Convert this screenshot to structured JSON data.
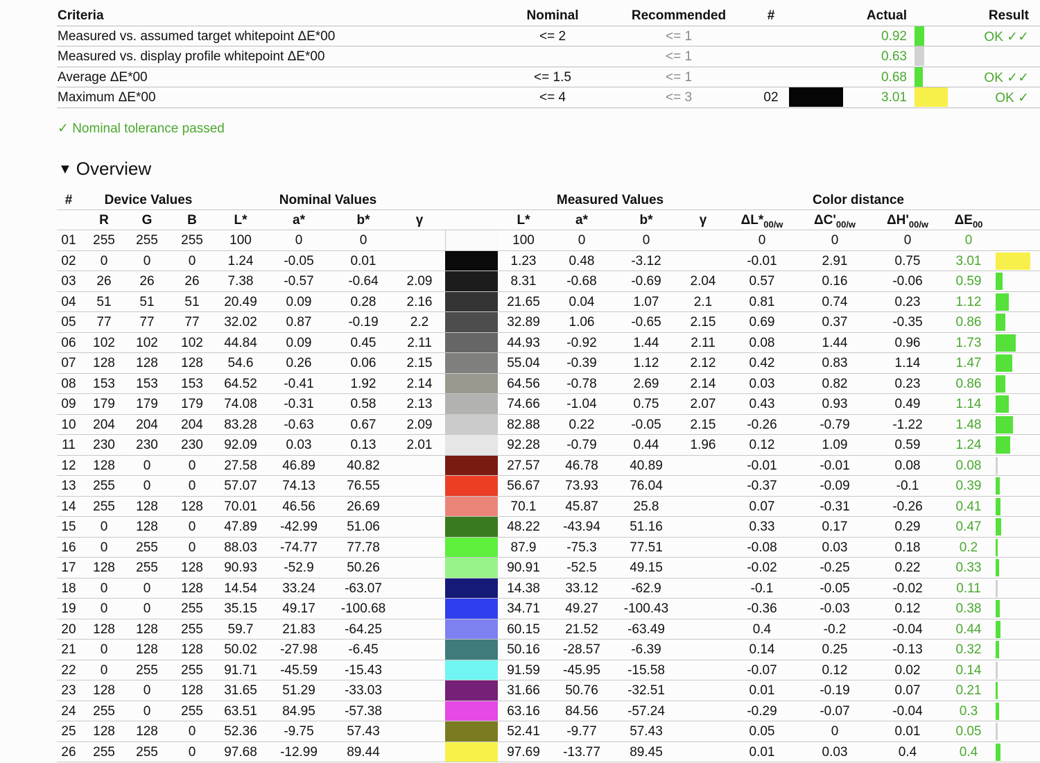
{
  "criteria": {
    "headers": {
      "criteria": "Criteria",
      "nominal": "Nominal",
      "recommended": "Recommended",
      "num": "#",
      "actual": "Actual",
      "result": "Result"
    },
    "rows": [
      {
        "criteria": "Measured vs. assumed target whitepoint ΔE*00",
        "nominal": "<= 2",
        "recommended": "<= 1",
        "num": "",
        "actual": "0.92",
        "result": "OK ✓✓",
        "bar_color": "#55e03a",
        "bar_fraction": 0.3
      },
      {
        "criteria": "Measured vs. display profile whitepoint ΔE*00",
        "nominal": "",
        "recommended": "<= 1",
        "num": "",
        "actual": "0.63",
        "result": "",
        "bar_color": "#d2d2d2",
        "bar_fraction": 0.3
      },
      {
        "criteria": "Average ΔE*00",
        "nominal": "<= 1.5",
        "recommended": "<= 1",
        "num": "",
        "actual": "0.68",
        "result": "OK ✓✓",
        "bar_color": "#55e03a",
        "bar_fraction": 0.25
      },
      {
        "criteria": "Maximum ΔE*00",
        "nominal": "<= 4",
        "recommended": "<= 3",
        "num": "02",
        "actual": "3.01",
        "result": "OK ✓",
        "bar_color": "#f7ef4a",
        "bar_fraction": 1.0,
        "swatch": "#050505"
      }
    ]
  },
  "status": "✓ Nominal tolerance passed",
  "overview": {
    "title": "Overview",
    "groups": {
      "num": "#",
      "device": "Device Values",
      "nominal": "Nominal Values",
      "measured": "Measured Values",
      "distance": "Color distance"
    },
    "columns": [
      "R",
      "G",
      "B",
      "L*",
      "a*",
      "b*",
      "γ",
      "L*",
      "a*",
      "b*",
      "γ"
    ],
    "dist_cols": [
      {
        "main": "ΔL*",
        "sub": "00/w"
      },
      {
        "main": "ΔC'",
        "sub": "00/w"
      },
      {
        "main": "ΔH'",
        "sub": "00/w"
      },
      {
        "main": "ΔE",
        "sub": "00"
      }
    ],
    "rows": [
      {
        "n": "01",
        "r": "255",
        "g": "255",
        "b": "255",
        "nL": "100",
        "na": "0",
        "nb": "0",
        "ng": "",
        "mL": "100",
        "ma": "0",
        "mb": "0",
        "mg": "",
        "dL": "0",
        "dC": "0",
        "dH": "0",
        "dE": "0",
        "color": "#fafafa"
      },
      {
        "n": "02",
        "r": "0",
        "g": "0",
        "b": "0",
        "nL": "1.24",
        "na": "-0.05",
        "nb": "0.01",
        "ng": "",
        "mL": "1.23",
        "ma": "0.48",
        "mb": "-3.12",
        "mg": "",
        "dL": "-0.01",
        "dC": "2.91",
        "dH": "0.75",
        "dE": "3.01",
        "color": "#0a0a0a"
      },
      {
        "n": "03",
        "r": "26",
        "g": "26",
        "b": "26",
        "nL": "7.38",
        "na": "-0.57",
        "nb": "-0.64",
        "ng": "2.09",
        "mL": "8.31",
        "ma": "-0.68",
        "mb": "-0.69",
        "mg": "2.04",
        "dL": "0.57",
        "dC": "0.16",
        "dH": "-0.06",
        "dE": "0.59",
        "color": "#1c1c1c"
      },
      {
        "n": "04",
        "r": "51",
        "g": "51",
        "b": "51",
        "nL": "20.49",
        "na": "0.09",
        "nb": "0.28",
        "ng": "2.16",
        "mL": "21.65",
        "ma": "0.04",
        "mb": "1.07",
        "mg": "2.1",
        "dL": "0.81",
        "dC": "0.74",
        "dH": "0.23",
        "dE": "1.12",
        "color": "#343434"
      },
      {
        "n": "05",
        "r": "77",
        "g": "77",
        "b": "77",
        "nL": "32.02",
        "na": "0.87",
        "nb": "-0.19",
        "ng": "2.2",
        "mL": "32.89",
        "ma": "1.06",
        "mb": "-0.65",
        "mg": "2.15",
        "dL": "0.69",
        "dC": "0.37",
        "dH": "-0.35",
        "dE": "0.86",
        "color": "#4d4d4d"
      },
      {
        "n": "06",
        "r": "102",
        "g": "102",
        "b": "102",
        "nL": "44.84",
        "na": "0.09",
        "nb": "0.45",
        "ng": "2.11",
        "mL": "44.93",
        "ma": "-0.92",
        "mb": "1.44",
        "mg": "2.11",
        "dL": "0.08",
        "dC": "1.44",
        "dH": "0.96",
        "dE": "1.73",
        "color": "#666666"
      },
      {
        "n": "07",
        "r": "128",
        "g": "128",
        "b": "128",
        "nL": "54.6",
        "na": "0.26",
        "nb": "0.06",
        "ng": "2.15",
        "mL": "55.04",
        "ma": "-0.39",
        "mb": "1.12",
        "mg": "2.12",
        "dL": "0.42",
        "dC": "0.83",
        "dH": "1.14",
        "dE": "1.47",
        "color": "#7f7f7d"
      },
      {
        "n": "08",
        "r": "153",
        "g": "153",
        "b": "153",
        "nL": "64.52",
        "na": "-0.41",
        "nb": "1.92",
        "ng": "2.14",
        "mL": "64.56",
        "ma": "-0.78",
        "mb": "2.69",
        "mg": "2.14",
        "dL": "0.03",
        "dC": "0.82",
        "dH": "0.23",
        "dE": "0.86",
        "color": "#99998f"
      },
      {
        "n": "09",
        "r": "179",
        "g": "179",
        "b": "179",
        "nL": "74.08",
        "na": "-0.31",
        "nb": "0.58",
        "ng": "2.13",
        "mL": "74.66",
        "ma": "-1.04",
        "mb": "0.75",
        "mg": "2.07",
        "dL": "0.43",
        "dC": "0.93",
        "dH": "0.49",
        "dE": "1.14",
        "color": "#b2b2b0"
      },
      {
        "n": "10",
        "r": "204",
        "g": "204",
        "b": "204",
        "nL": "83.28",
        "na": "-0.63",
        "nb": "0.67",
        "ng": "2.09",
        "mL": "82.88",
        "ma": "0.22",
        "mb": "-0.05",
        "mg": "2.15",
        "dL": "-0.26",
        "dC": "-0.79",
        "dH": "-1.22",
        "dE": "1.48",
        "color": "#cbcbcb"
      },
      {
        "n": "11",
        "r": "230",
        "g": "230",
        "b": "230",
        "nL": "92.09",
        "na": "0.03",
        "nb": "0.13",
        "ng": "2.01",
        "mL": "92.28",
        "ma": "-0.79",
        "mb": "0.44",
        "mg": "1.96",
        "dL": "0.12",
        "dC": "1.09",
        "dH": "0.59",
        "dE": "1.24",
        "color": "#e6e6e6"
      },
      {
        "n": "12",
        "r": "128",
        "g": "0",
        "b": "0",
        "nL": "27.58",
        "na": "46.89",
        "nb": "40.82",
        "ng": "",
        "mL": "27.57",
        "ma": "46.78",
        "mb": "40.89",
        "mg": "",
        "dL": "-0.01",
        "dC": "-0.01",
        "dH": "0.08",
        "dE": "0.08",
        "color": "#7a1b12"
      },
      {
        "n": "13",
        "r": "255",
        "g": "0",
        "b": "0",
        "nL": "57.07",
        "na": "74.13",
        "nb": "76.55",
        "ng": "",
        "mL": "56.67",
        "ma": "73.93",
        "mb": "76.04",
        "mg": "",
        "dL": "-0.37",
        "dC": "-0.09",
        "dH": "-0.1",
        "dE": "0.39",
        "color": "#ec3e25"
      },
      {
        "n": "14",
        "r": "255",
        "g": "128",
        "b": "128",
        "nL": "70.01",
        "na": "46.56",
        "nb": "26.69",
        "ng": "",
        "mL": "70.1",
        "ma": "45.87",
        "mb": "25.8",
        "mg": "",
        "dL": "0.07",
        "dC": "-0.31",
        "dH": "-0.26",
        "dE": "0.41",
        "color": "#ec8579"
      },
      {
        "n": "15",
        "r": "0",
        "g": "128",
        "b": "0",
        "nL": "47.89",
        "na": "-42.99",
        "nb": "51.06",
        "ng": "",
        "mL": "48.22",
        "ma": "-43.94",
        "mb": "51.16",
        "mg": "",
        "dL": "0.33",
        "dC": "0.17",
        "dH": "0.29",
        "dE": "0.47",
        "color": "#3a7a1f"
      },
      {
        "n": "16",
        "r": "0",
        "g": "255",
        "b": "0",
        "nL": "88.03",
        "na": "-74.77",
        "nb": "77.78",
        "ng": "",
        "mL": "87.9",
        "ma": "-75.3",
        "mb": "77.51",
        "mg": "",
        "dL": "-0.08",
        "dC": "0.03",
        "dH": "0.18",
        "dE": "0.2",
        "color": "#5ef03c"
      },
      {
        "n": "17",
        "r": "128",
        "g": "255",
        "b": "128",
        "nL": "90.93",
        "na": "-52.9",
        "nb": "50.26",
        "ng": "",
        "mL": "90.91",
        "ma": "-52.5",
        "mb": "49.15",
        "mg": "",
        "dL": "-0.02",
        "dC": "-0.25",
        "dH": "0.22",
        "dE": "0.33",
        "color": "#98f38a"
      },
      {
        "n": "18",
        "r": "0",
        "g": "0",
        "b": "128",
        "nL": "14.54",
        "na": "33.24",
        "nb": "-63.07",
        "ng": "",
        "mL": "14.38",
        "ma": "33.12",
        "mb": "-62.9",
        "mg": "",
        "dL": "-0.1",
        "dC": "-0.05",
        "dH": "-0.02",
        "dE": "0.11",
        "color": "#151a78"
      },
      {
        "n": "19",
        "r": "0",
        "g": "0",
        "b": "255",
        "nL": "35.15",
        "na": "49.17",
        "nb": "-100.68",
        "ng": "",
        "mL": "34.71",
        "ma": "49.27",
        "mb": "-100.43",
        "mg": "",
        "dL": "-0.36",
        "dC": "-0.03",
        "dH": "0.12",
        "dE": "0.38",
        "color": "#2f3ff0"
      },
      {
        "n": "20",
        "r": "128",
        "g": "128",
        "b": "255",
        "nL": "59.7",
        "na": "21.83",
        "nb": "-64.25",
        "ng": "",
        "mL": "60.15",
        "ma": "21.52",
        "mb": "-63.49",
        "mg": "",
        "dL": "0.4",
        "dC": "-0.2",
        "dH": "-0.04",
        "dE": "0.44",
        "color": "#7c80f0"
      },
      {
        "n": "21",
        "r": "0",
        "g": "128",
        "b": "128",
        "nL": "50.02",
        "na": "-27.98",
        "nb": "-6.45",
        "ng": "",
        "mL": "50.16",
        "ma": "-28.57",
        "mb": "-6.39",
        "mg": "",
        "dL": "0.14",
        "dC": "0.25",
        "dH": "-0.13",
        "dE": "0.32",
        "color": "#3f7b7b"
      },
      {
        "n": "22",
        "r": "0",
        "g": "255",
        "b": "255",
        "nL": "91.71",
        "na": "-45.59",
        "nb": "-15.43",
        "ng": "",
        "mL": "91.59",
        "ma": "-45.95",
        "mb": "-15.58",
        "mg": "",
        "dL": "-0.07",
        "dC": "0.12",
        "dH": "0.02",
        "dE": "0.14",
        "color": "#70f5f2"
      },
      {
        "n": "23",
        "r": "128",
        "g": "0",
        "b": "128",
        "nL": "31.65",
        "na": "51.29",
        "nb": "-33.03",
        "ng": "",
        "mL": "31.66",
        "ma": "50.76",
        "mb": "-32.51",
        "mg": "",
        "dL": "0.01",
        "dC": "-0.19",
        "dH": "0.07",
        "dE": "0.21",
        "color": "#762077"
      },
      {
        "n": "24",
        "r": "255",
        "g": "0",
        "b": "255",
        "nL": "63.51",
        "na": "84.95",
        "nb": "-57.38",
        "ng": "",
        "mL": "63.16",
        "ma": "84.56",
        "mb": "-57.24",
        "mg": "",
        "dL": "-0.29",
        "dC": "-0.07",
        "dH": "-0.04",
        "dE": "0.3",
        "color": "#e549e6"
      },
      {
        "n": "25",
        "r": "128",
        "g": "128",
        "b": "0",
        "nL": "52.36",
        "na": "-9.75",
        "nb": "57.43",
        "ng": "",
        "mL": "52.41",
        "ma": "-9.77",
        "mb": "57.43",
        "mg": "",
        "dL": "0.05",
        "dC": "0",
        "dH": "0.01",
        "dE": "0.05",
        "color": "#7b7b22"
      },
      {
        "n": "26",
        "r": "255",
        "g": "255",
        "b": "0",
        "nL": "97.68",
        "na": "-12.99",
        "nb": "89.44",
        "ng": "",
        "mL": "97.69",
        "ma": "-13.77",
        "mb": "89.45",
        "mg": "",
        "dL": "0.01",
        "dC": "0.03",
        "dH": "0.4",
        "dE": "0.4",
        "color": "#f7f24a"
      }
    ]
  }
}
